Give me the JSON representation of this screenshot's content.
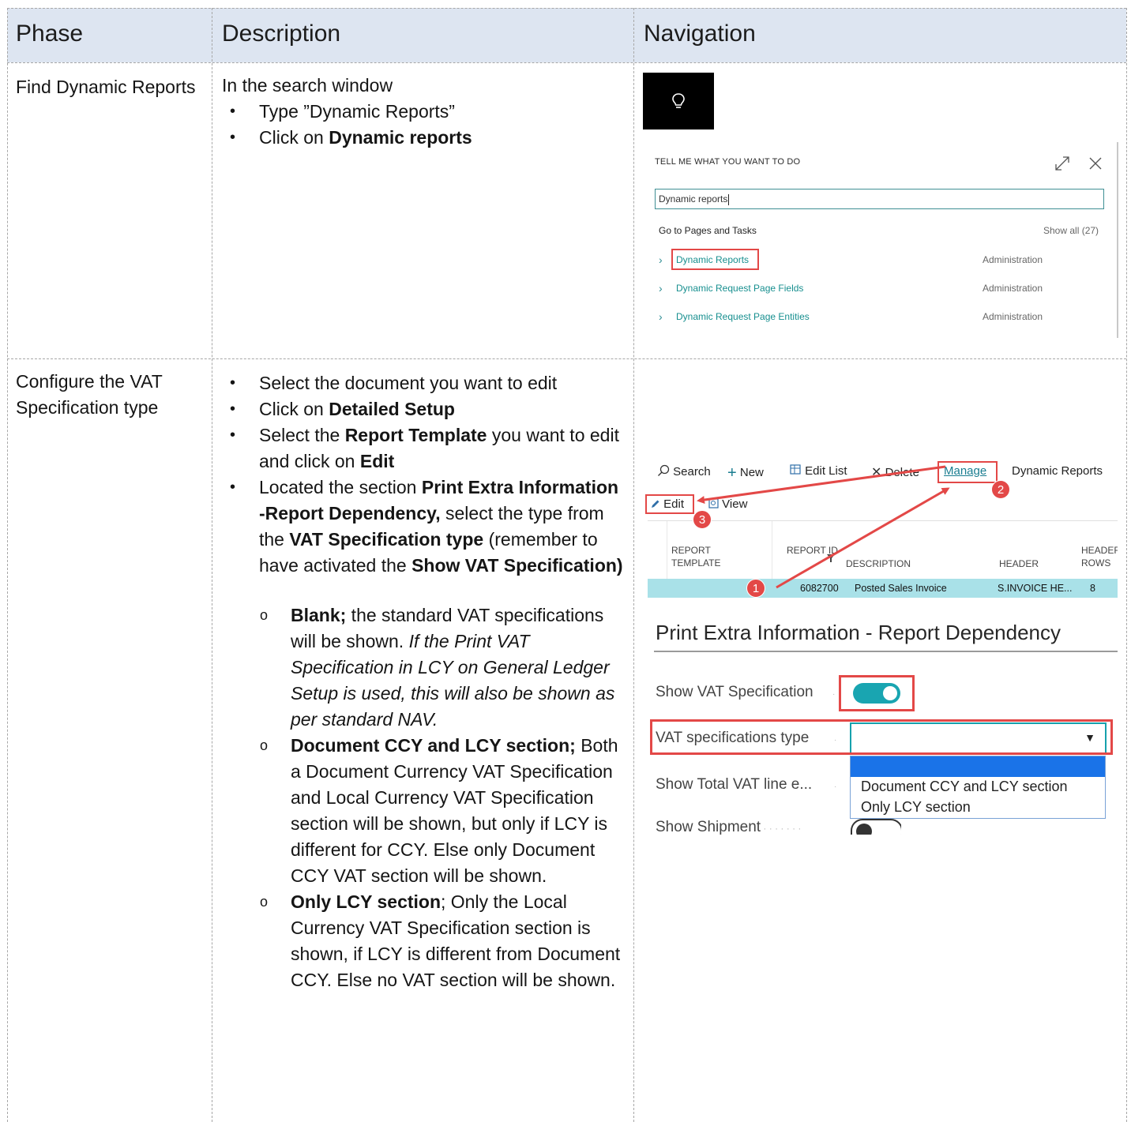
{
  "table": {
    "headers": {
      "phase": "Phase",
      "description": "Description",
      "navigation": "Navigation"
    },
    "rows": [
      {
        "phase": "Find Dynamic Reports",
        "intro": "In the search window",
        "step1": "Type ”Dynamic Reports”",
        "step2_prefix": "Click on ",
        "step2_bold": "Dynamic reports"
      },
      {
        "phase": "Configure the VAT Specification type",
        "b1": "Select the document you want to edit",
        "b2_prefix": "Click on ",
        "b2_bold": "Detailed Setup",
        "b3_prefix": "Select the ",
        "b3_bold1": "Report Template",
        "b3_mid": " you want to edit and click on ",
        "b3_bold2": "Edit",
        "b4_prefix": "Located the section ",
        "b4_bold1": "Print Extra Information -Report Dependency,",
        "b4_mid": " select the type from the ",
        "b4_bold2": "VAT Specification type",
        "b4_mid2": " (remember to have activated the ",
        "b4_bold3": "Show VAT Specification)",
        "o1_bold": "Blank;",
        "o1_text": " the standard VAT specifications will be shown. ",
        "o1_italic": "If the Print VAT Specification in LCY on General Ledger Setup is used, this will also be shown as per standard NAV.",
        "o2_bold": "Document CCY and LCY section;",
        "o2_text": " Both a Document Currency VAT Specification and Local Currency VAT Specification section will be shown, but only if LCY is different for CCY. Else only Document CCY VAT section will be shown.",
        "o3_bold": "Only LCY section",
        "o3_text": "; Only the Local Currency VAT Specification section is shown, if LCY is different from Document CCY. Else no VAT section will be shown."
      }
    ]
  },
  "tell_me": {
    "title": "TELL ME WHAT YOU WANT TO DO",
    "search_value": "Dynamic reports",
    "section": "Go to Pages and Tasks",
    "show_all": "Show all (27)",
    "results": [
      {
        "label": "Dynamic Reports",
        "category": "Administration"
      },
      {
        "label": "Dynamic Request Page Fields",
        "category": "Administration"
      },
      {
        "label": "Dynamic Request Page Entities",
        "category": "Administration"
      }
    ]
  },
  "report_page": {
    "toolbar": {
      "search": "Search",
      "new": "New",
      "edit_list": "Edit List",
      "delete": "Delete",
      "manage": "Manage",
      "page_name": "Dynamic Reports",
      "edit": "Edit",
      "view": "View"
    },
    "columns": {
      "report_template_1": "REPORT",
      "report_template_2": "TEMPLATE",
      "report_id": "REPORT ID",
      "description": "DESCRIPTION",
      "header": "HEADER",
      "header_rows_1": "HEADER",
      "header_rows_2": "ROWS"
    },
    "row": {
      "report_id": "6082700",
      "description": "Posted Sales Invoice",
      "header": "S.INVOICE HE...",
      "header_rows": "8"
    },
    "badges": [
      "1",
      "2",
      "3"
    ]
  },
  "extra_info": {
    "title": "Print Extra Information - Report Dependency",
    "show_vat_label": "Show VAT Specification",
    "show_vat_value": true,
    "vat_type_label": "VAT specifications type",
    "vat_type_value": "",
    "options": [
      "",
      "Document CCY and LCY section",
      "Only LCY section"
    ],
    "show_total_label": "Show Total VAT line e...",
    "show_shipment_label": "Show Shipment"
  },
  "colors": {
    "header_band": "#dde5f1",
    "accent_teal": "#19a5b1",
    "annotation_red": "#e34847",
    "selected_row": "#a9e1e8",
    "dropdown_highlight": "#1a73e8"
  }
}
